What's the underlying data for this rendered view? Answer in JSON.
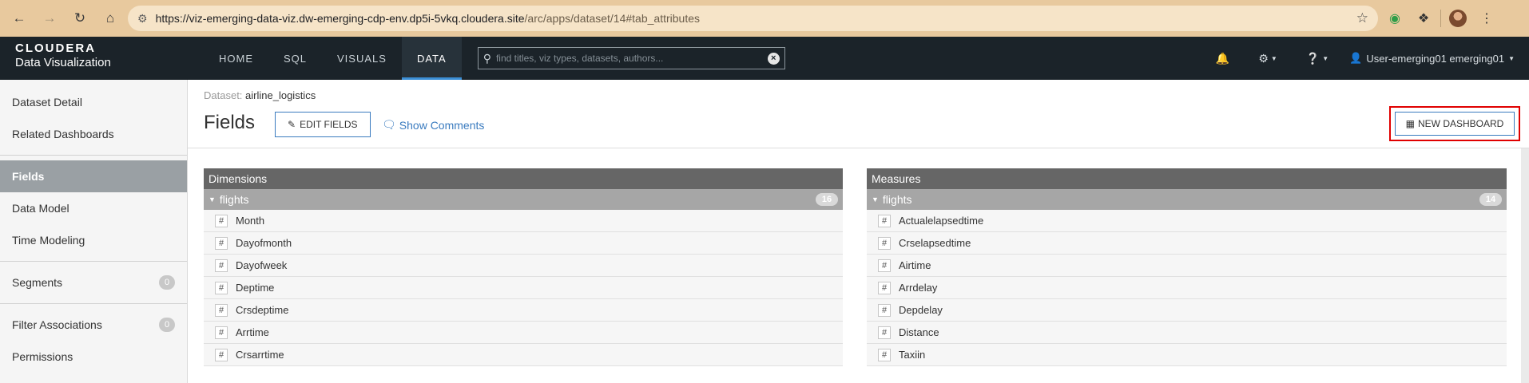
{
  "browser": {
    "url_main": "https://viz-emerging-data-viz.dw-emerging-cdp-env.dp5i-5vkq.cloudera.site",
    "url_path": "/arc/apps/dataset/14#tab_attributes"
  },
  "app": {
    "logo": "CLOUDERA",
    "product": "Data Visualization",
    "nav": [
      "HOME",
      "SQL",
      "VISUALS",
      "DATA"
    ],
    "active_nav": "DATA",
    "search_placeholder": "find titles, viz types, datasets, authors...",
    "user": "User-emerging01 emerging01"
  },
  "sidebar": {
    "items": [
      {
        "label": "Dataset Detail"
      },
      {
        "label": "Related Dashboards"
      },
      {
        "label": "Fields"
      },
      {
        "label": "Data Model"
      },
      {
        "label": "Time Modeling"
      },
      {
        "label": "Segments",
        "count": "0"
      },
      {
        "label": "Filter Associations",
        "count": "0"
      },
      {
        "label": "Permissions"
      }
    ]
  },
  "content": {
    "dataset_label": "Dataset:",
    "dataset_name": "airline_logistics",
    "title": "Fields",
    "edit_fields": "EDIT FIELDS",
    "show_comments": "Show Comments",
    "new_dashboard": "NEW DASHBOARD"
  },
  "dimensions": {
    "header": "Dimensions",
    "group": "flights",
    "count": "16",
    "fields": [
      "Month",
      "Dayofmonth",
      "Dayofweek",
      "Deptime",
      "Crsdeptime",
      "Arrtime",
      "Crsarrtime"
    ]
  },
  "measures": {
    "header": "Measures",
    "group": "flights",
    "count": "14",
    "fields": [
      "Actualelapsedtime",
      "Crselapsedtime",
      "Airtime",
      "Arrdelay",
      "Depdelay",
      "Distance",
      "Taxiin"
    ]
  },
  "colors": {
    "appbar": "#1b2329",
    "accent": "#3b8fd6",
    "highlight": "#e00000"
  }
}
